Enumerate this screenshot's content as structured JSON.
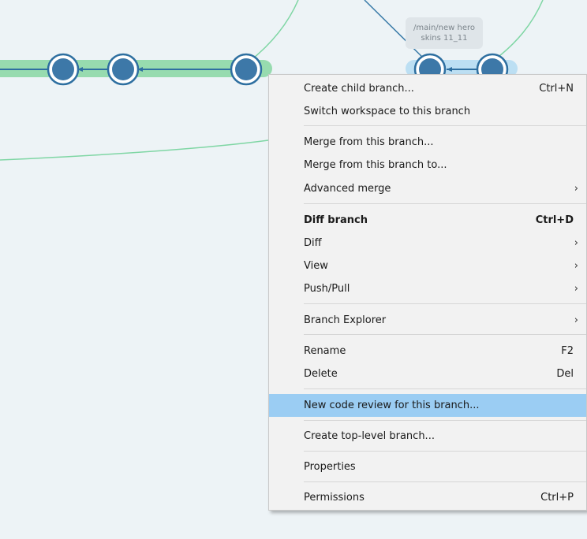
{
  "graph": {
    "branch_label_line1": "/main/new hero",
    "branch_label_line2": "skins 11_11"
  },
  "menu": {
    "items": [
      {
        "label": "Create child branch...",
        "shortcut": "Ctrl+N"
      },
      {
        "label": "Switch workspace to this branch",
        "shortcut": ""
      },
      {
        "label": "Merge from this branch...",
        "shortcut": ""
      },
      {
        "label": "Merge from this branch to...",
        "shortcut": ""
      },
      {
        "label": "Advanced merge",
        "shortcut": ""
      },
      {
        "label": "Diff branch",
        "shortcut": "Ctrl+D"
      },
      {
        "label": "Diff",
        "shortcut": ""
      },
      {
        "label": "View",
        "shortcut": ""
      },
      {
        "label": "Push/Pull",
        "shortcut": ""
      },
      {
        "label": "Branch Explorer",
        "shortcut": ""
      },
      {
        "label": "Rename",
        "shortcut": "F2"
      },
      {
        "label": "Delete",
        "shortcut": "Del"
      },
      {
        "label": "New code review for this branch...",
        "shortcut": ""
      },
      {
        "label": "Create top-level branch...",
        "shortcut": ""
      },
      {
        "label": "Properties",
        "shortcut": ""
      },
      {
        "label": "Permissions",
        "shortcut": "Ctrl+P"
      }
    ],
    "submenu_arrow": "›"
  }
}
